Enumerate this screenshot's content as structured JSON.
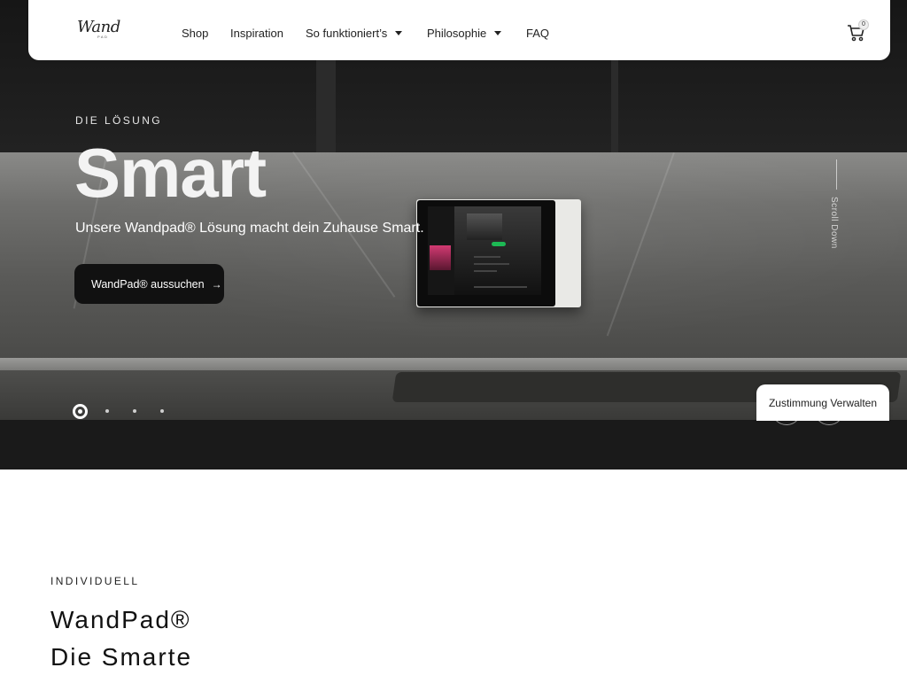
{
  "navbar": {
    "logo_text": "Wand",
    "logo_sub": "PAD",
    "items": [
      {
        "label": "Shop",
        "has_dropdown": false
      },
      {
        "label": "Inspiration",
        "has_dropdown": false
      },
      {
        "label": "So funktioniert’s",
        "has_dropdown": true
      },
      {
        "label": "Philosophie",
        "has_dropdown": true
      },
      {
        "label": "FAQ",
        "has_dropdown": false
      }
    ],
    "cart_count": "0",
    "cart_icon": "cart-icon"
  },
  "hero": {
    "eyebrow": "DIE LÖSUNG",
    "title": "Smart",
    "subtitle": "Unsere Wandpad® Lösung macht dein Zuhause Smart.",
    "cta_label": "WandPad® aussuchen",
    "cta_icon": "arrow-right-icon",
    "scroll_label": "Scroll Down",
    "slider": {
      "total_slides": 4,
      "active_slide": 1
    }
  },
  "consent": {
    "label": "Zustimmung Verwalten"
  },
  "section": {
    "eyebrow": "INDIVIDUELL",
    "heading_line1": "WandPad®",
    "heading_line2": "Die Smarte"
  },
  "colors": {
    "dark": "#111111",
    "white": "#ffffff",
    "hero_bg": "#1a1a1a"
  }
}
